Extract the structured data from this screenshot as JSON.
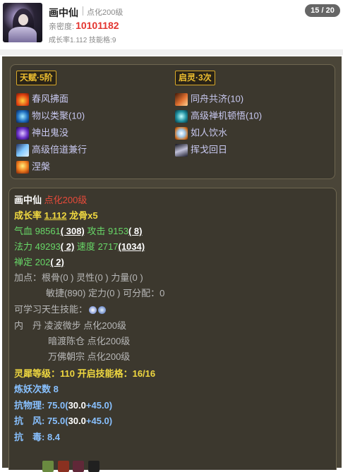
{
  "header": {
    "name": "画中仙",
    "level": "点化200级",
    "intimacy_label": "亲密度:",
    "intimacy_value": "10101182",
    "growth_line": "成长率1.112 技能格:9",
    "page_badge": "15 / 20"
  },
  "talents": {
    "left_title": "天赋·5阶",
    "right_title": "启灵·3次",
    "left_items": [
      {
        "label": "春风拂面",
        "icon": "fire-palm-icon"
      },
      {
        "label": "物以类聚(10)",
        "icon": "water-orb-icon"
      },
      {
        "label": "神出鬼没",
        "icon": "ghost-rune-icon"
      },
      {
        "label": "高级倍道兼行",
        "icon": "swift-wind-icon"
      },
      {
        "label": "涅槃",
        "icon": "phoenix-fire-icon"
      }
    ],
    "right_items": [
      {
        "label": "同舟共济(10)",
        "icon": "boat-strike-icon"
      },
      {
        "label": "高级禅机顿悟(10)",
        "icon": "zen-rune-icon"
      },
      {
        "label": "如人饮水",
        "icon": "drinking-water-icon"
      },
      {
        "label": "挥戈回日",
        "icon": "spear-sun-icon"
      }
    ]
  },
  "detail": {
    "name": "画中仙",
    "level": "点化200级",
    "growth_label": "成长率",
    "growth_value": "1.112",
    "bone": "龙骨x5",
    "hp_label": "气血",
    "hp_value": "98561",
    "hp_bonus": "( 308)",
    "atk_label": "攻击",
    "atk_value": "9153",
    "atk_bonus": "( 8)",
    "mp_label": "法力",
    "mp_value": "49293",
    "mp_bonus": "( 2)",
    "spd_label": "速度",
    "spd_value": "2717",
    "spd_bonus": "(1034)",
    "focus_label": "禅定",
    "focus_value": "202",
    "focus_bonus": "( 2)",
    "points_line1": "加点：根骨(0 ) 灵性(0 ) 力量(0 )",
    "points_line2": "敏捷(890) 定力(0 ) 可分配：0",
    "learnable_label": "可学习天生技能：",
    "neidan_label": "内　丹",
    "neidan_items": [
      "凌波微步 点化200级",
      "暗渡陈仓 点化200级",
      "万佛朝宗 点化200级"
    ],
    "soul_line": "灵犀等级：110 开启技能格：16/16",
    "refine_line": "炼妖次数 8",
    "phys_label": "抗物理: 75.0(",
    "phys_base": "30.0",
    "phys_extra": "+45.0)",
    "wind_label": "抗　风: 75.0(",
    "wind_base": "30.0",
    "wind_extra": "+45.0)",
    "poison_line": "抗　毒: 8.4"
  }
}
